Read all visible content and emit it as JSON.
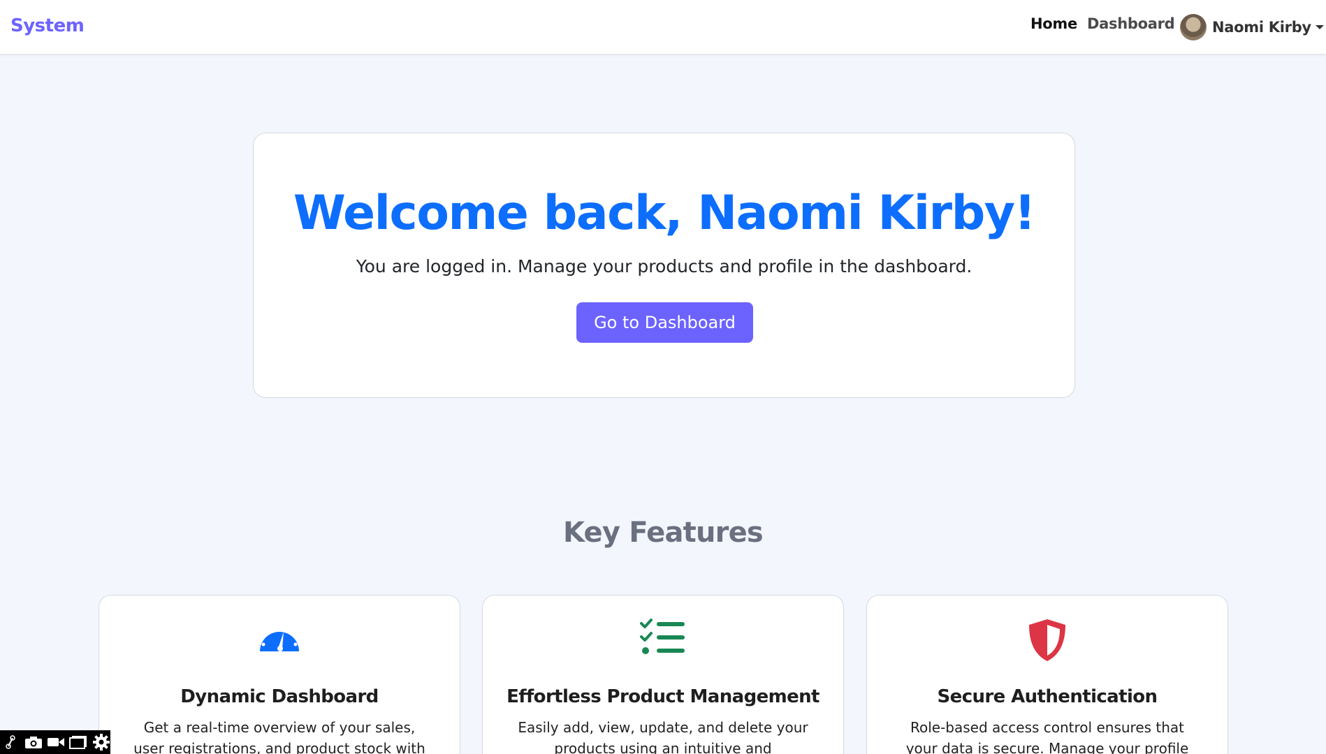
{
  "nav": {
    "brand": "System",
    "home_label": "Home",
    "dashboard_label": "Dashboard",
    "user_name": "Naomi Kirby"
  },
  "hero": {
    "title": "Welcome back, Naomi Kirby!",
    "subtitle": "You are logged in. Manage your products and profile in the dashboard.",
    "button_label": "Go to Dashboard"
  },
  "features": {
    "title": "Key Features",
    "items": [
      {
        "icon": "speedometer-icon",
        "title": "Dynamic Dashboard",
        "description": "Get a real-time overview of your sales, user registrations, and product stock with"
      },
      {
        "icon": "checklist-icon",
        "title": "Effortless Product Management",
        "description": "Easily add, view, update, and delete your products using an intuitive and"
      },
      {
        "icon": "shield-icon",
        "title": "Secure Authentication",
        "description": "Role-based access control ensures that your data is secure. Manage your profile"
      }
    ]
  },
  "colors": {
    "brand": "#6c63ff",
    "heading_blue": "#0d6efd",
    "icon_green": "#198754",
    "icon_red": "#dc3545",
    "background": "#f3f6fc"
  },
  "toolbar": {
    "icons": [
      "link-icon",
      "camera-icon",
      "video-icon",
      "window-icon",
      "gear-icon"
    ]
  }
}
